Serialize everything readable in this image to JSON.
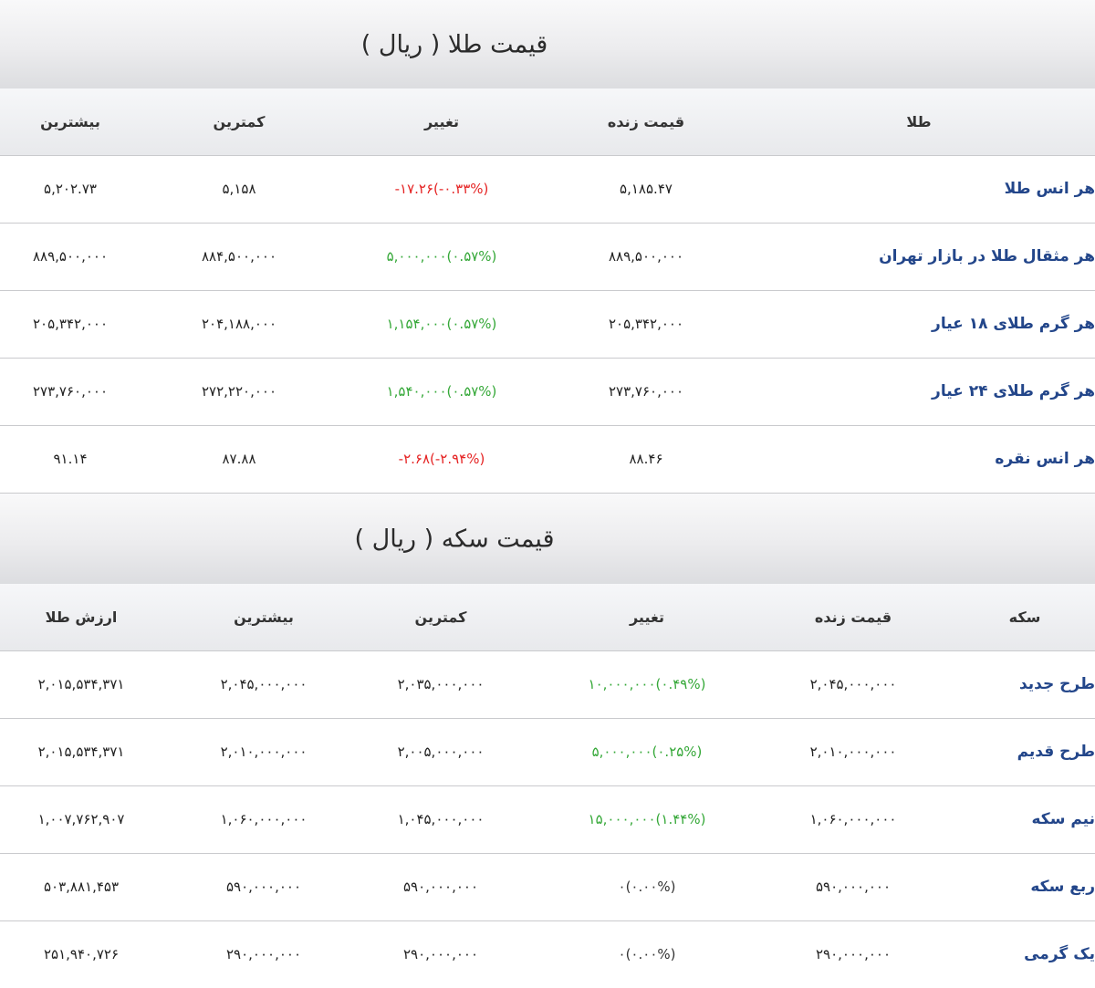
{
  "gold_section": {
    "title": "قیمت طلا ( ریال )",
    "headers": {
      "name": "طلا",
      "live": "قیمت زنده",
      "change": "تغییر",
      "min": "کمترین",
      "max": "بیشترین"
    },
    "rows": [
      {
        "name": "هر انس طلا",
        "live": "۵,۱۸۵.۴۷",
        "change": "-۱۷.۲۶(-۰.۳۳%)",
        "change_sign": "neg",
        "min": "۵,۱۵۸",
        "max": "۵,۲۰۲.۷۳"
      },
      {
        "name": "هر مثقال طلا در بازار تهران",
        "live": "۸۸۹,۵۰۰,۰۰۰",
        "change": "۵,۰۰۰,۰۰۰(۰.۵۷%)",
        "change_sign": "pos",
        "min": "۸۸۴,۵۰۰,۰۰۰",
        "max": "۸۸۹,۵۰۰,۰۰۰"
      },
      {
        "name": "هر گرم طلای ۱۸ عیار",
        "live": "۲۰۵,۳۴۲,۰۰۰",
        "change": "۱,۱۵۴,۰۰۰(۰.۵۷%)",
        "change_sign": "pos",
        "min": "۲۰۴,۱۸۸,۰۰۰",
        "max": "۲۰۵,۳۴۲,۰۰۰"
      },
      {
        "name": "هر گرم طلای ۲۴ عیار",
        "live": "۲۷۳,۷۶۰,۰۰۰",
        "change": "۱,۵۴۰,۰۰۰(۰.۵۷%)",
        "change_sign": "pos",
        "min": "۲۷۲,۲۲۰,۰۰۰",
        "max": "۲۷۳,۷۶۰,۰۰۰"
      },
      {
        "name": "هر انس نقره",
        "live": "۸۸.۴۶",
        "change": "-۲.۶۸(-۲.۹۴%)",
        "change_sign": "neg",
        "min": "۸۷.۸۸",
        "max": "۹۱.۱۴"
      }
    ]
  },
  "coin_section": {
    "title": "قیمت سکه ( ریال )",
    "headers": {
      "name": "سکه",
      "live": "قیمت زنده",
      "change": "تغییر",
      "min": "کمترین",
      "max": "بیشترین",
      "gold_value": "ارزش طلا"
    },
    "rows": [
      {
        "name": "طرح جدید",
        "live": "۲,۰۴۵,۰۰۰,۰۰۰",
        "change": "۱۰,۰۰۰,۰۰۰(۰.۴۹%)",
        "change_sign": "pos",
        "min": "۲,۰۳۵,۰۰۰,۰۰۰",
        "max": "۲,۰۴۵,۰۰۰,۰۰۰",
        "gold_value": "۲,۰۱۵,۵۳۴,۳۷۱"
      },
      {
        "name": "طرح قدیم",
        "live": "۲,۰۱۰,۰۰۰,۰۰۰",
        "change": "۵,۰۰۰,۰۰۰(۰.۲۵%)",
        "change_sign": "pos",
        "min": "۲,۰۰۵,۰۰۰,۰۰۰",
        "max": "۲,۰۱۰,۰۰۰,۰۰۰",
        "gold_value": "۲,۰۱۵,۵۳۴,۳۷۱"
      },
      {
        "name": "نیم سکه",
        "live": "۱,۰۶۰,۰۰۰,۰۰۰",
        "change": "۱۵,۰۰۰,۰۰۰(۱.۴۴%)",
        "change_sign": "pos",
        "min": "۱,۰۴۵,۰۰۰,۰۰۰",
        "max": "۱,۰۶۰,۰۰۰,۰۰۰",
        "gold_value": "۱,۰۰۷,۷۶۲,۹۰۷"
      },
      {
        "name": "ربع سکه",
        "live": "۵۹۰,۰۰۰,۰۰۰",
        "change": "۰(۰.۰۰%)",
        "change_sign": "neu",
        "min": "۵۹۰,۰۰۰,۰۰۰",
        "max": "۵۹۰,۰۰۰,۰۰۰",
        "gold_value": "۵۰۳,۸۸۱,۴۵۳"
      },
      {
        "name": "یک گرمی",
        "live": "۲۹۰,۰۰۰,۰۰۰",
        "change": "۰(۰.۰۰%)",
        "change_sign": "neu",
        "min": "۲۹۰,۰۰۰,۰۰۰",
        "max": "۲۹۰,۰۰۰,۰۰۰",
        "gold_value": "۲۵۱,۹۴۰,۷۲۶"
      }
    ]
  }
}
